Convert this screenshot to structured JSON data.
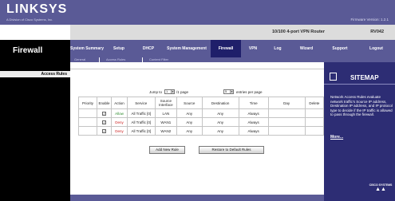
{
  "brand": {
    "logo": "LINKSYS",
    "division": "A Division of Cisco Systems, Inc."
  },
  "firmware": "Firmware Version: 1.2.1",
  "product": {
    "name": "10/100 4-port VPN Router",
    "model": "RV042"
  },
  "page_title": "Firewall",
  "tabs": [
    {
      "label": "System Summary"
    },
    {
      "label": "Setup"
    },
    {
      "label": "DHCP"
    },
    {
      "label": "System Management"
    },
    {
      "label": "Firewall"
    },
    {
      "label": "VPN"
    },
    {
      "label": "Log"
    },
    {
      "label": "Wizard"
    },
    {
      "label": "Support"
    },
    {
      "label": "Logout"
    }
  ],
  "subtabs": [
    {
      "label": "General"
    },
    {
      "label": "Access Rules"
    },
    {
      "label": "Content Filter"
    }
  ],
  "section_label": "Access Rules",
  "pagination": {
    "jump_prefix": "Jump to",
    "jump_value": "1",
    "jump_suffix": "/1 page",
    "entries_value": "5",
    "entries_suffix": "entries per page"
  },
  "table": {
    "headers": [
      "Priority",
      "Enable",
      "Action",
      "Service",
      "Source Interface",
      "Source",
      "Destination",
      "Time",
      "Day",
      "Delete"
    ],
    "rows": [
      {
        "priority": "",
        "enabled": "✓",
        "action": "Allow",
        "service": "All Traffic [0]",
        "interface": "LAN",
        "source": "Any",
        "destination": "Any",
        "time": "Always",
        "day": "",
        "delete": ""
      },
      {
        "priority": "",
        "enabled": "✓",
        "action": "Deny",
        "service": "All Traffic [0]",
        "interface": "WAN1",
        "source": "Any",
        "destination": "Any",
        "time": "Always",
        "day": "",
        "delete": ""
      },
      {
        "priority": "",
        "enabled": "✓",
        "action": "Deny",
        "service": "All Traffic [0]",
        "interface": "WAN2",
        "source": "Any",
        "destination": "Any",
        "time": "Always",
        "day": "",
        "delete": ""
      }
    ]
  },
  "buttons": {
    "add": "Add New Rule",
    "restore": "Restore to Default Rules"
  },
  "sitemap": {
    "title": "SITEMAP",
    "help": "Network Access Rules evaluate network traffic's Source IP address, Destination IP address, and IP protocol type to decide if the IP traffic is allowed to pass through the firewall.",
    "more": "More..."
  },
  "cisco": {
    "name": "CISCO SYSTEMS",
    "bars": "▲▲"
  },
  "colors": {
    "nav": "#5a5a96",
    "active_tab": "#1f1f6a",
    "sitemap": "#2d2d74",
    "allow": "#2b8a2b",
    "deny": "#cc2222"
  },
  "icons": {
    "sitemap": "sitemap-icon",
    "checkbox": "checkbox-checked-icon",
    "dropdown": "chevron-down-icon"
  }
}
